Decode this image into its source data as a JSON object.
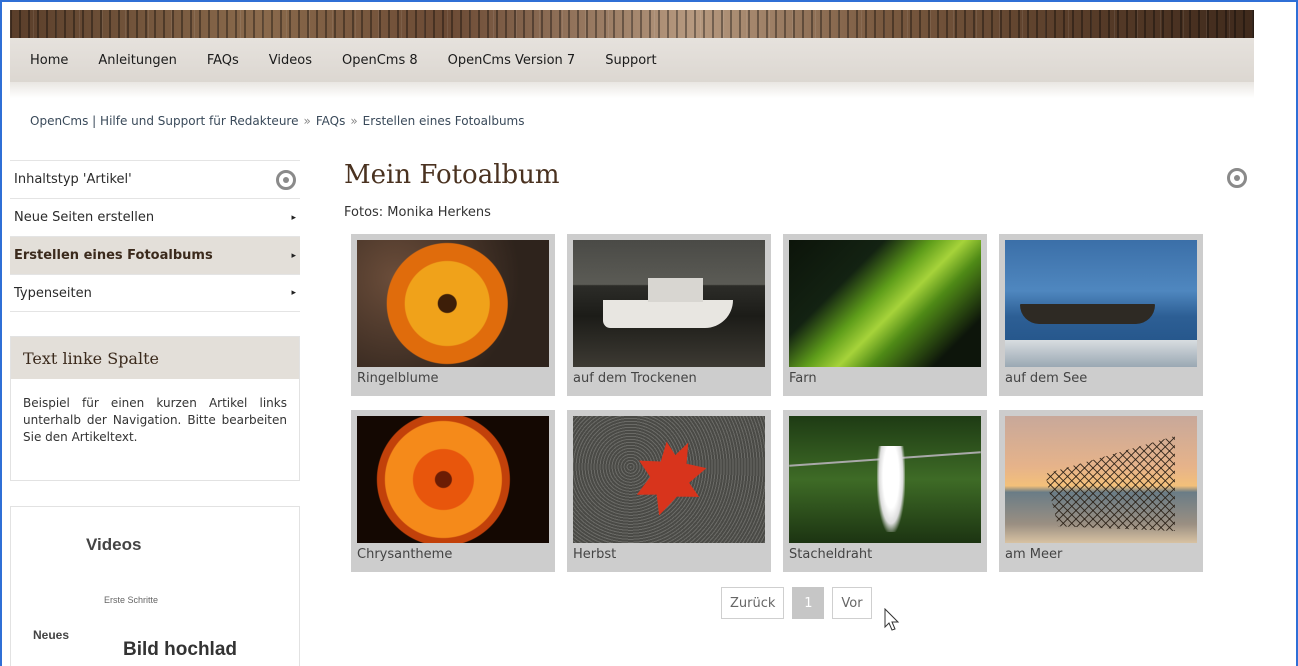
{
  "topnav": {
    "items": [
      "Home",
      "Anleitungen",
      "FAQs",
      "Videos",
      "OpenCms 8",
      "OpenCms Version 7",
      "Support"
    ]
  },
  "breadcrumb": {
    "items": [
      "OpenCms | Hilfe und Support für Redakteure",
      "FAQs",
      "Erstellen eines Fotoalbums"
    ],
    "separator": "»"
  },
  "sidenav": {
    "items": [
      {
        "label": "Inhaltstyp 'Artikel'"
      },
      {
        "label": "Neue Seiten erstellen",
        "arrow": "▸"
      },
      {
        "label": "Erstellen eines Fotoalbums",
        "arrow": "▸"
      },
      {
        "label": "Typenseiten",
        "arrow": "▸"
      }
    ]
  },
  "textbox": {
    "title": "Text linke Spalte",
    "body": "Beispiel für einen kurzen Artikel links unterhalb der Navigation. Bitte bearbeiten Sie den Artikeltext."
  },
  "videobox": {
    "title": "Videos",
    "subtitle": "Erste Schritte",
    "label_new": "Neues",
    "upload": "Bild hochlad"
  },
  "main": {
    "title": "Mein Fotoalbum",
    "subtitle": "Fotos: Monika Herkens"
  },
  "gallery": {
    "captions": [
      "Ringelblume",
      "auf dem Trockenen",
      "Farn",
      "auf dem See",
      "Chrysantheme",
      "Herbst",
      "Stacheldraht",
      "am Meer"
    ]
  },
  "pager": {
    "prev": "Zurück",
    "current": "1",
    "next": "Vor"
  },
  "icons": {
    "settings_ring": "target-icon",
    "cursor": "mouse-cursor-icon"
  },
  "colors": {
    "accent_brown": "#4a3220",
    "nav_bg": "#e3dfd9",
    "frame_blue": "#2f6fd6"
  }
}
